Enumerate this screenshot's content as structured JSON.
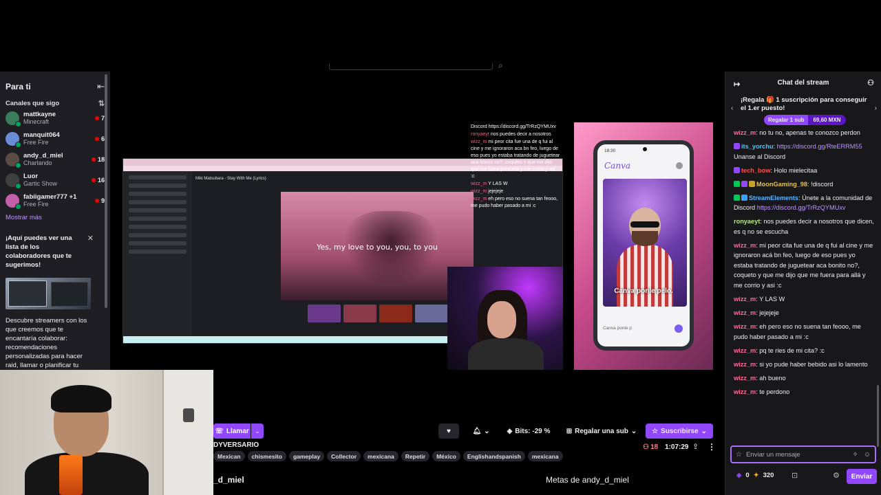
{
  "sidebar": {
    "title": "Para ti",
    "section_label": "Canales que sigo",
    "channels": [
      {
        "name": "mattkayne",
        "game": "Minecraft",
        "viewers": "7",
        "color": "#3a7d5a"
      },
      {
        "name": "manquit064",
        "game": "Free Fire",
        "viewers": "6",
        "color": "#6a8bd6"
      },
      {
        "name": "andy_d_miel",
        "game": "Charlando",
        "viewers": "18",
        "color": "#5a4b44"
      },
      {
        "name": "Luor",
        "game": "Gartic Show",
        "viewers": "16",
        "color": "#404040"
      },
      {
        "name": "fabiigamer777 +1",
        "game": "Free Fire",
        "viewers": "9",
        "color": "#c25fa8"
      }
    ],
    "show_more": "Mostrar más",
    "promo_title": "¡Aquí puedes ver una lista de los colaboradores que te sugerimos!",
    "promo_desc": "Descubre streamers con los que creemos que te encantaría colaborar: recomendaciones personalizadas para hacer raid, llamar o planificar tu"
  },
  "stream": {
    "lyric": "Yes, my love to you, you, to you",
    "song_title": "Miki Matsubara - Stay With Me (Lyrics)",
    "phone_caption": "Canva ponle pelo.",
    "phone_input": "Canva ponle p",
    "phone_time": "18:30",
    "canva_logo": "Canva",
    "overlay_chat": [
      {
        "user": "",
        "text": "Discord https://discord.gg/TrRzQYMUxv"
      },
      {
        "user": "ronyaeyt",
        "text": "nos puedes decir a nosotros"
      },
      {
        "user": "wizz_m",
        "text": "mi peor cita fue una de q fui al cine y me ignoraron aca bn feo, luego de eso pues yo estaba tratando de juguetear aca bonito no?, coqueto y que me dijo que me fuera para allá y me corrio y asi :c"
      },
      {
        "user": "wizz_m",
        "text": "Y LAS W"
      },
      {
        "user": "wizz_m",
        "text": "jejejeje"
      },
      {
        "user": "wizz_m",
        "text": "eh pero eso no suena tan feooo, me pudo haber pasado a mi :c"
      }
    ]
  },
  "controls": {
    "call_label": "Llamar",
    "bits_label": "Bits: -29 %",
    "gift_label": "Regalar una sub",
    "subscribe_label": "Suscribirse",
    "viewers": "18",
    "uptime": "1:07:29",
    "stream_title": "DYVERSARIO",
    "tags": [
      "Mexican",
      "chismesito",
      "gameplay",
      "Collector",
      "mexicana",
      "Repetir",
      "México",
      "Englishandspanish",
      "mexicana"
    ],
    "streamer_name": "_d_miel",
    "goals_title": "Metas de andy_d_miel"
  },
  "chat": {
    "title": "Chat del stream",
    "gift_banner_text": "¡Regala 🎁 1 suscripción para conseguir el 1.er puesto!",
    "gift_button": "Regalar 1 sub",
    "gift_price": "69,60 MXN",
    "messages": [
      {
        "user": "wizz_m",
        "color": "#ff6b9a",
        "badges": [],
        "text": " no tu no, apenas te conozco perdon",
        "link": ""
      },
      {
        "user": "its_yorchu",
        "color": "#4fc3f7",
        "badges": [
          "#9147ff"
        ],
        "text": "",
        "link": "https://discord.gg/RteERRM55",
        "after": " Unanse al Discord"
      },
      {
        "user": "tech_bow",
        "color": "#ff4f4f",
        "badges": [
          "#9147ff"
        ],
        "text": " Holo mielecitaa",
        "link": ""
      },
      {
        "user": "MoonGaming_98",
        "color": "#e8c34a",
        "badges": [
          "#00c853",
          "#9147ff",
          "#c9a227"
        ],
        "text": " !discord",
        "link": ""
      },
      {
        "user": "StreamElements",
        "color": "#5ab4ff",
        "badges": [
          "#00c853",
          "#3aa0ff"
        ],
        "text": " Únete a la comunidad de Discord ",
        "link": "https://discord.gg/TrRzQYMUxv"
      },
      {
        "user": "ronyaeyt",
        "color": "#b8e986",
        "badges": [],
        "text": " nos puedes decir a nosotros que dicen, es q no se escucha",
        "link": ""
      },
      {
        "user": "wizz_m",
        "color": "#ff6b9a",
        "badges": [],
        "text": " mi peor cita fue una de q fui al cine y me ignoraron acá bn feo, luego de eso pues yo estaba tratando de juguetear aca bonito no?, coqueto y que me dijo que me fuera para allá y me corrio y asi :c",
        "link": ""
      },
      {
        "user": "wizz_m",
        "color": "#ff6b9a",
        "badges": [],
        "text": " Y LAS W",
        "link": ""
      },
      {
        "user": "wizz_m",
        "color": "#ff6b9a",
        "badges": [],
        "text": " jejejeje",
        "link": ""
      },
      {
        "user": "wizz_m",
        "color": "#ff6b9a",
        "badges": [],
        "text": " eh pero eso no suena tan feooo, me pudo haber pasado a mi :c",
        "link": ""
      },
      {
        "user": "wizz_m",
        "color": "#ff6b9a",
        "badges": [],
        "text": " pq te ries de mi cita? :c",
        "link": ""
      },
      {
        "user": "wizz_m",
        "color": "#ff6b9a",
        "badges": [],
        "text": " si yo pude haber bebido asi lo lamento",
        "link": ""
      },
      {
        "user": "wizz_m",
        "color": "#ff6b9a",
        "badges": [],
        "text": " ah bueno",
        "link": ""
      },
      {
        "user": "wizz_m",
        "color": "#ff6b9a",
        "badges": [],
        "text": " te perdono",
        "link": ""
      }
    ],
    "input_placeholder": "Enviar un mensaje",
    "bits": "0",
    "points": "320",
    "send_label": "Enviar"
  },
  "icons": {
    "collapse": "arrow-left-icon",
    "sort": "sort-icon",
    "close": "close-icon",
    "heart": "heart-icon",
    "bell": "bell-icon",
    "star": "star-icon",
    "gift": "gift-icon",
    "share": "share-icon",
    "more": "more-icon"
  },
  "colors": {
    "accent": "#9147ff",
    "link": "#bf94ff",
    "live": "#eb0400"
  }
}
